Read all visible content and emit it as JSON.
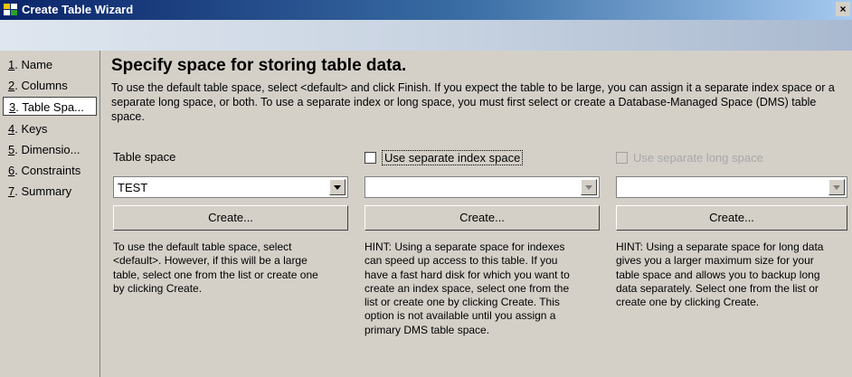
{
  "window": {
    "title": "Create Table Wizard",
    "close_label": "×"
  },
  "nav": {
    "items": [
      {
        "num": "1",
        "label": ". Name"
      },
      {
        "num": "2",
        "label": ". Columns"
      },
      {
        "num": "3",
        "label": ". Table Spa..."
      },
      {
        "num": "4",
        "label": ". Keys"
      },
      {
        "num": "5",
        "label": ". Dimensio..."
      },
      {
        "num": "6",
        "label": ". Constraints"
      },
      {
        "num": "7",
        "label": ". Summary"
      }
    ],
    "active_index": 2
  },
  "page": {
    "heading": "Specify space for storing table data.",
    "intro": "To use the default table space, select <default> and click Finish. If you expect the table to be large, you can assign it a separate index space or a separate long space, or both. To use a separate index or long space, you must first select or create a Database-Managed Space (DMS) table space."
  },
  "columns": {
    "table_space": {
      "label": "Table space",
      "selected_value": "TEST",
      "create_button": "Create...",
      "hint": "To use the default table space, select <default>. However, if this will be a large table, select one from the list or create one by clicking Create."
    },
    "index_space": {
      "checkbox_label": "Use separate index space",
      "checked": false,
      "selected_value": "",
      "create_button": "Create...",
      "hint": "HINT: Using a separate space for indexes can speed up access to this table. If you have a fast hard disk for which you want to create an index space, select one from the list or create one by clicking Create. This option is not available until you assign a primary DMS table space."
    },
    "long_space": {
      "checkbox_label": "Use separate long space",
      "checked": false,
      "enabled": false,
      "selected_value": "",
      "create_button": "Create...",
      "hint": "HINT: Using a separate space for long data gives you a larger maximum size for your table space and allows you to backup long data separately. Select one from the list or create one by clicking Create."
    }
  },
  "colors": {
    "titlebar_start": "#0a246a",
    "titlebar_end": "#a6caf0",
    "window_bg": "#d4d0c8",
    "disabled_text": "#a8a8a8"
  }
}
